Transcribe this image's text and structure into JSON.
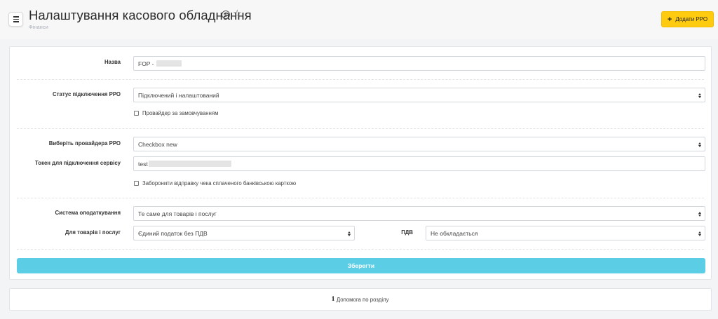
{
  "header": {
    "title": "Налаштування касового обладнання",
    "breadcrumb": "Фінанси",
    "add_button_label": "Додати РРО"
  },
  "form": {
    "name": {
      "label": "Назва",
      "value": "FOP -"
    },
    "status": {
      "label": "Статус підключення РРО",
      "value": "Підключений і налаштований",
      "default_provider_label": "Провайдер за замовчуванням"
    },
    "provider": {
      "label": "Виберіть провайдера РРО",
      "value": "Checkbox new"
    },
    "token": {
      "label": "Токен для підключення сервісу",
      "value": "test",
      "block_receipt_label": "Заборонити відправку чека сплаченого банківською карткою"
    },
    "tax_system": {
      "label": "Система оподаткування",
      "value": "Те саме для товарів і послуг"
    },
    "goods_services": {
      "label": "Для товарів і послуг",
      "value": "Єдиний податок без ПДВ"
    },
    "vat": {
      "label": "ПДВ",
      "value": "Не обкладається"
    },
    "save_label": "Зберегти"
  },
  "help": {
    "label": "Допомога по розділу"
  },
  "colors": {
    "accent_yellow": "#fecb10",
    "save_blue": "#5bcde4"
  },
  "icons": {
    "menu": "hamburger-icon",
    "info": "info-circle-icon",
    "favorite": "star-outline-icon",
    "add": "plus-icon",
    "help": "info-icon"
  }
}
